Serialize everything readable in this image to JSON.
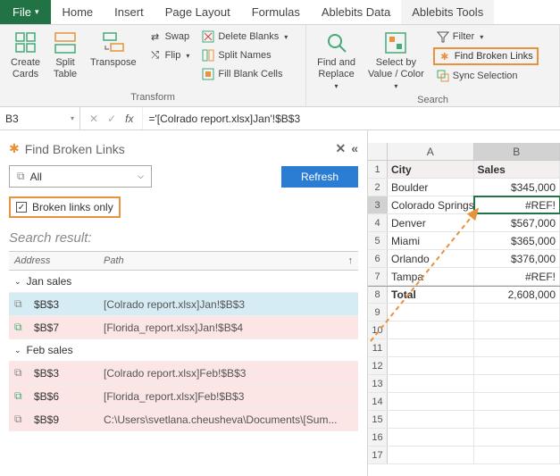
{
  "tabs": {
    "file": "File",
    "home": "Home",
    "insert": "Insert",
    "page_layout": "Page Layout",
    "formulas": "Formulas",
    "ablebits_data": "Ablebits Data",
    "ablebits_tools": "Ablebits Tools"
  },
  "ribbon": {
    "transform": {
      "label": "Transform",
      "create_cards": "Create\nCards",
      "split_table": "Split\nTable",
      "transpose": "Transpose",
      "swap": "Swap",
      "flip": "Flip",
      "delete_blanks": "Delete Blanks",
      "split_names": "Split Names",
      "fill_blank": "Fill Blank Cells"
    },
    "search": {
      "label": "Search",
      "find_replace": "Find and\nReplace",
      "select_by": "Select by\nValue / Color",
      "filter": "Filter",
      "find_broken": "Find Broken Links",
      "sync_sel": "Sync Selection"
    }
  },
  "formula_bar": {
    "name_box": "B3",
    "formula": "='[Colrado report.xlsx]Jan'!$B$3"
  },
  "pane": {
    "title": "Find Broken Links",
    "dropdown": "All",
    "refresh": "Refresh",
    "checkbox": "Broken links only",
    "search_result": "Search result:",
    "headers": {
      "address": "Address",
      "path": "Path"
    },
    "group1": "Jan sales",
    "group2": "Feb sales",
    "rows": {
      "r1": {
        "addr": "$B$3",
        "path": "[Colrado report.xlsx]Jan!$B$3"
      },
      "r2": {
        "addr": "$B$7",
        "path": "[Florida_report.xlsx]Jan!$B$4"
      },
      "r3": {
        "addr": "$B$3",
        "path": "[Colrado report.xlsx]Feb!$B$3"
      },
      "r4": {
        "addr": "$B$6",
        "path": "[Florida_report.xlsx]Feb!$B$3"
      },
      "r5": {
        "addr": "$B$9",
        "path": "C:\\Users\\svetlana.cheusheva\\Documents\\[Sum..."
      }
    }
  },
  "sheet": {
    "cols": {
      "a": "A",
      "b": "B"
    },
    "header": {
      "city": "City",
      "sales": "Sales"
    },
    "rows": {
      "r2": {
        "a": "Boulder",
        "b": "$345,000"
      },
      "r3": {
        "a": "Colorado Springs",
        "b": "#REF!"
      },
      "r4": {
        "a": "Denver",
        "b": "$567,000"
      },
      "r5": {
        "a": "Miami",
        "b": "$365,000"
      },
      "r6": {
        "a": "Orlando",
        "b": "$376,000"
      },
      "r7": {
        "a": "Tampa",
        "b": "#REF!"
      },
      "r8": {
        "a": "Total",
        "b": "2,608,000"
      }
    }
  }
}
